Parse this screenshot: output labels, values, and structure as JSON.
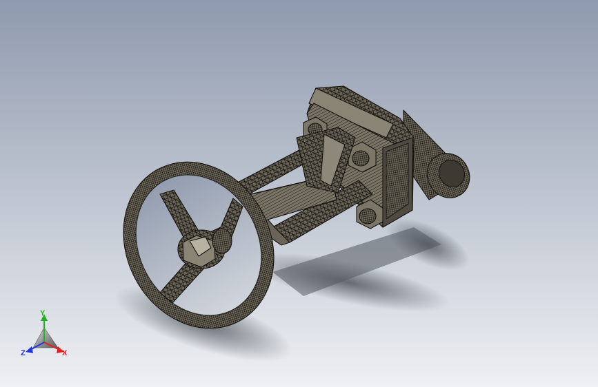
{
  "viewport": {
    "background_top": "#8f9aae",
    "background_bottom": "#eef0f3",
    "model_color": "#5e5a4f",
    "wire_color": "#15130f",
    "shadow_color": "#2a2f38"
  },
  "model": {
    "icon": "gate-valve-model"
  },
  "triad": {
    "x_label": "X",
    "y_label": "Y",
    "z_label": "Z",
    "x_color": "#e0201c",
    "y_color": "#1fb41f",
    "z_color": "#1f35e0"
  }
}
